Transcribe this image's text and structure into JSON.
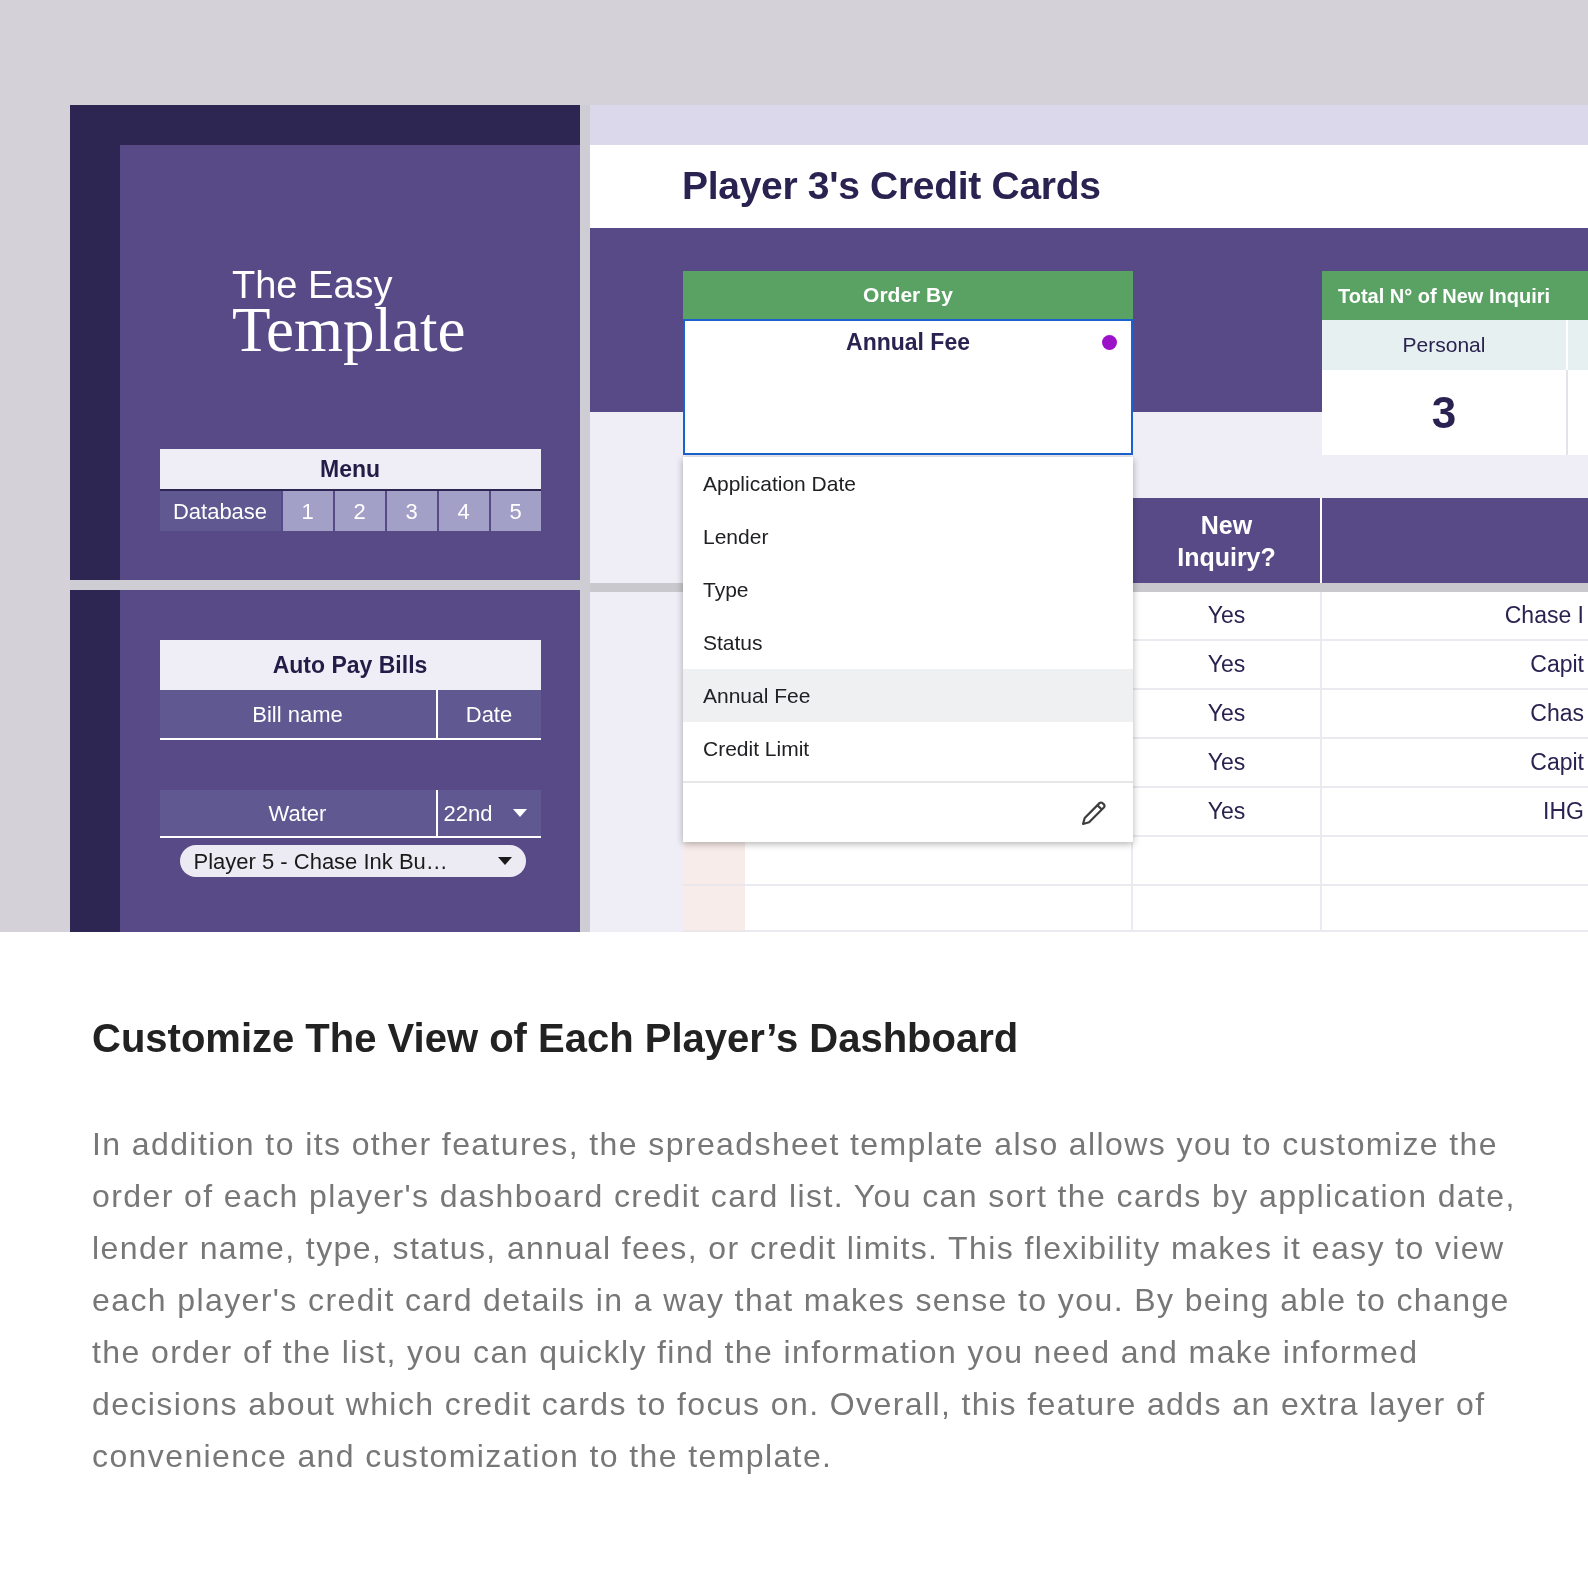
{
  "sidebar": {
    "logo": {
      "line_1": "The Easy",
      "line_2": "Template"
    },
    "menu": {
      "title": "Menu",
      "label": "Database",
      "links": [
        "1",
        "2",
        "3",
        "4",
        "5"
      ]
    },
    "bills": {
      "title": "Auto Pay Bills",
      "columns": [
        "Bill name",
        "Date"
      ],
      "rows": [
        {
          "name": "Water",
          "date": "22nd"
        }
      ],
      "selector": "Player 5 - Chase Ink Bu…"
    }
  },
  "sheet": {
    "title": "Player 3's Credit Cards",
    "order_by": {
      "label": "Order By",
      "value": "Annual Fee",
      "options": [
        {
          "label": "Application Date",
          "selected": false
        },
        {
          "label": "Lender",
          "selected": false
        },
        {
          "label": "Type",
          "selected": false
        },
        {
          "label": "Status",
          "selected": false
        },
        {
          "label": "Annual Fee",
          "selected": true
        },
        {
          "label": "Credit Limit",
          "selected": false
        }
      ]
    },
    "inquiries": {
      "title": "Total N° of New Inquiri",
      "columns": [
        {
          "label": "Personal",
          "count": "3"
        }
      ]
    },
    "table": {
      "columns": [
        "New Inquiry?"
      ],
      "rows": [
        [
          "Yes",
          "Chase I"
        ],
        [
          "Yes",
          "Capit"
        ],
        [
          "Yes",
          "Chas"
        ],
        [
          "Yes",
          "Capit"
        ],
        [
          "Yes",
          "IHG"
        ]
      ]
    }
  },
  "article": {
    "heading": "Customize The View of Each Player’s Dashboard",
    "body": "In addition to its other features, the spreadsheet template also allows you to customize the order of each player's dashboard credit card list. You can sort the cards by application date, lender name, type, status, annual fees, or credit limits. This flexibility makes it easy to view each player's credit card details in a way that makes sense to you. By being able to change the order of the list, you can quickly find the information you need and make informed decisions about which credit cards to focus on. Overall, this feature adds an extra layer of convenience and customization to the template."
  }
}
